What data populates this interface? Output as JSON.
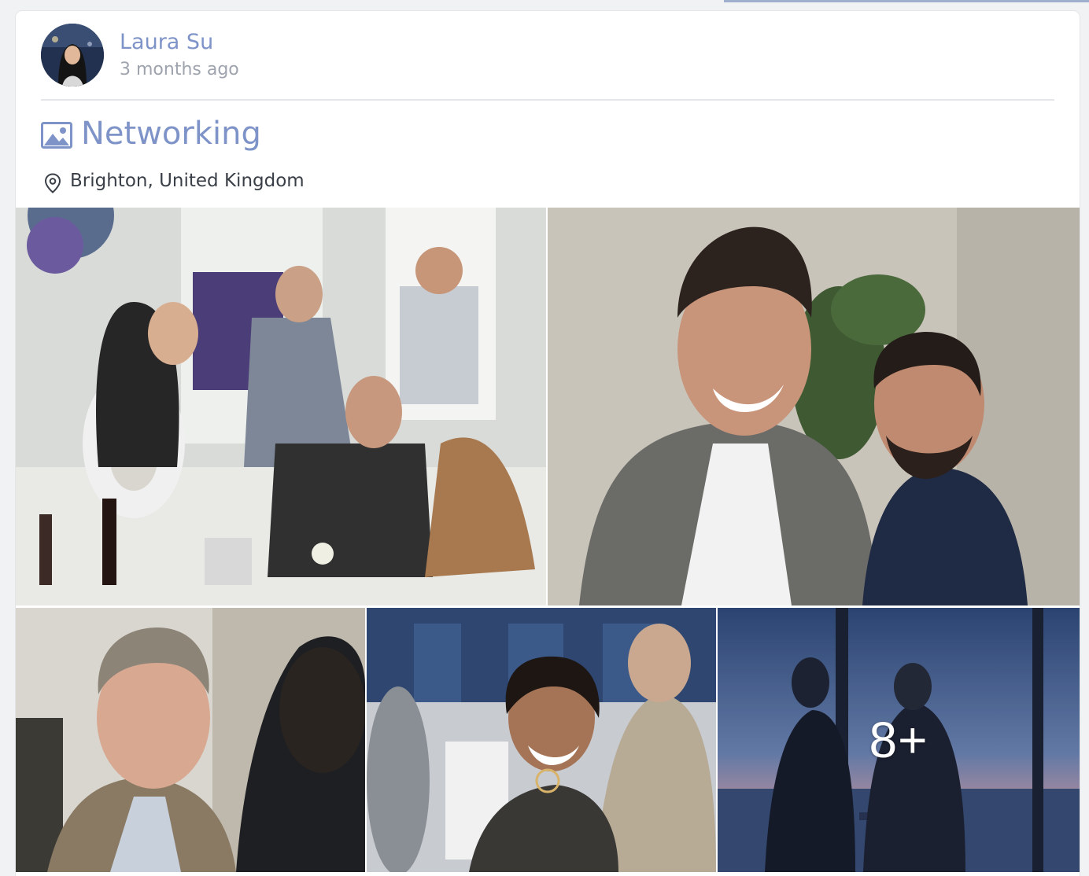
{
  "post": {
    "author_name": "Laura Su",
    "time_ago": "3 months ago",
    "avatar_icon": "user-avatar-photo"
  },
  "album": {
    "icon": "image-icon",
    "title": "Networking",
    "location_icon": "map-pin-icon",
    "location": "Brighton, United Kingdom"
  },
  "gallery": {
    "photos": [
      {
        "alt": "Guests at dinner tables at the networking event"
      },
      {
        "alt": "Two smiling men in suits"
      },
      {
        "alt": "Older man smiling in conversation"
      },
      {
        "alt": "Woman smiling in a leather jacket"
      },
      {
        "alt": "Two men silhouetted by a window at dusk"
      }
    ],
    "more_count_label": "8+"
  },
  "colors": {
    "link": "#7e93c8",
    "muted": "#9ea3ad",
    "text": "#3a3f47",
    "divider": "#e4e6ea"
  }
}
